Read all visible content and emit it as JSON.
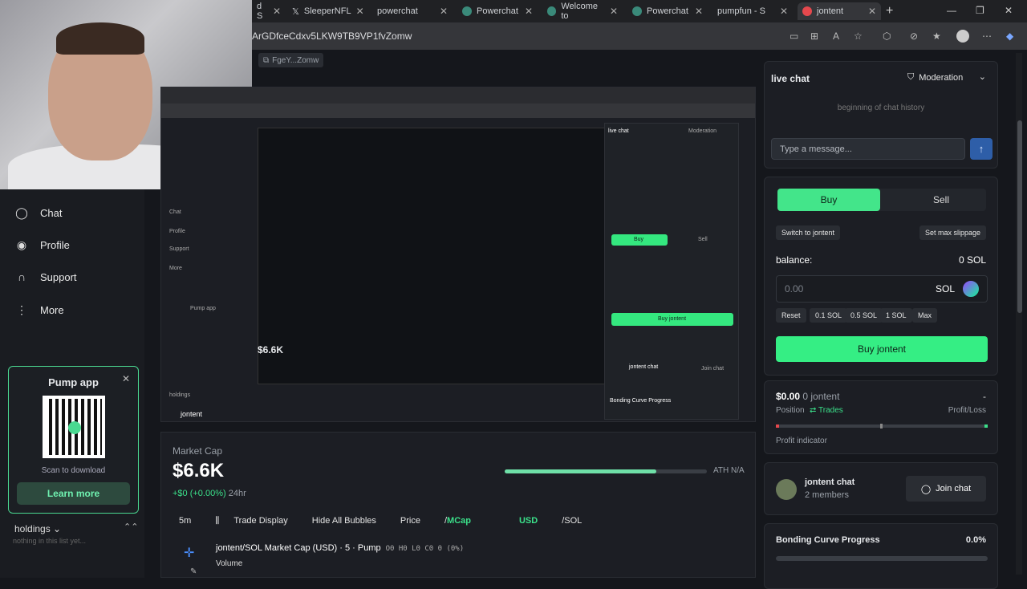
{
  "browser": {
    "tabs": [
      {
        "label": "d S"
      },
      {
        "label": "SleeperNFL"
      },
      {
        "label": "powerchat"
      },
      {
        "label": "Powerchat"
      },
      {
        "label": "Welcome to"
      },
      {
        "label": "Powerchat"
      },
      {
        "label": "pumpfun - S"
      },
      {
        "label": "jontent"
      }
    ],
    "url": "ArGDfceCdxv5LKW9TB9VP1fvZomw",
    "new_tab": "+"
  },
  "contract_badge": "FgeY...Zomw",
  "leftnav": {
    "items": [
      {
        "label": "Chat",
        "icon": "chat-bubble-icon"
      },
      {
        "label": "Profile",
        "icon": "user-icon"
      },
      {
        "label": "Support",
        "icon": "headset-icon"
      },
      {
        "label": "More",
        "icon": "more-vertical-icon"
      }
    ]
  },
  "pump_app": {
    "title": "Pump app",
    "scan_text": "Scan to download",
    "learn_more": "Learn more"
  },
  "holdings": {
    "label": "holdings",
    "empty": "nothing in this list yet..."
  },
  "market": {
    "label": "Market Cap",
    "value": "$6.6K",
    "change": "+$0 (+0.00%)",
    "period": "24hr",
    "ath": "ATH N/A",
    "ath_progress": 0.75
  },
  "chart_toolbar": {
    "interval": "5m",
    "trade_display": "Trade Display",
    "hide_bubbles": "Hide All Bubbles",
    "price": "Price",
    "mcap": "MCap",
    "usd": "USD",
    "sol": "SOL"
  },
  "chart": {
    "title": "jontent/SOL Market Cap (USD) · 5 · Pump",
    "ohlc": "O0 H0 L0 C0 0 (0%)",
    "volume": "Volume"
  },
  "live_chat": {
    "title": "live chat",
    "moderation": "Moderation",
    "history": "beginning of chat history",
    "input_placeholder": "Type a message..."
  },
  "trade": {
    "buy_tab": "Buy",
    "sell_tab": "Sell",
    "switch": "Switch to jontent",
    "slippage": "Set max slippage",
    "balance_label": "balance:",
    "balance_value": "0 SOL",
    "amount_placeholder": "0.00",
    "currency": "SOL",
    "presets": [
      "Reset",
      "0.1 SOL",
      "0.5 SOL",
      "1 SOL",
      "Max"
    ],
    "buy_button": "Buy jontent"
  },
  "position": {
    "value": "$0.00",
    "token": "0 jontent",
    "dash": "-",
    "label": "Position",
    "trades": "Trades",
    "pl": "Profit/Loss",
    "indicator": "Profit indicator"
  },
  "jontent_chat": {
    "title": "jontent chat",
    "members": "2 members",
    "join": "Join chat"
  },
  "bonding": {
    "title": "Bonding Curve Progress",
    "pct": "0.0%"
  },
  "nested_preview": {
    "chat_title": "live chat",
    "moderation": "Moderation",
    "buy": "Buy",
    "sell": "Sell",
    "buy_button": "Buy jontent",
    "market_value": "$6.6K",
    "jontent_chat": "jontent chat",
    "join": "Join chat",
    "bonding": "Bonding Curve Progress",
    "nav_items": [
      "Chat",
      "Profile",
      "Support",
      "More"
    ],
    "pump_app": "Pump app",
    "holdings": "holdings",
    "user": "jontent"
  }
}
